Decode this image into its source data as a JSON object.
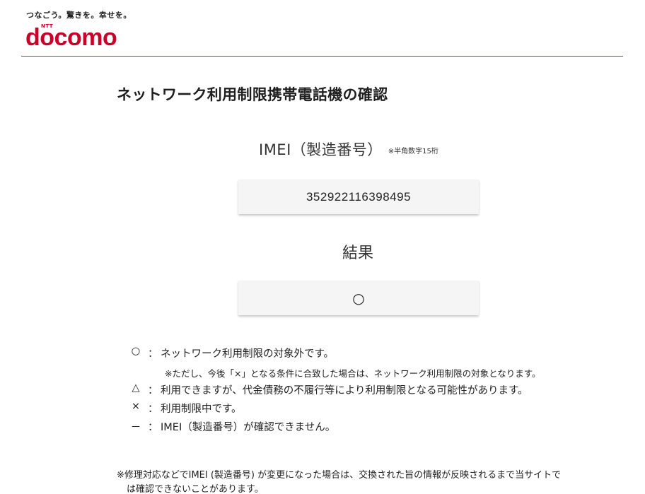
{
  "header": {
    "tagline": "つなごう。驚きを。幸せを。",
    "logo_ntt": "NTT",
    "logo_word": "docomo"
  },
  "page": {
    "title": "ネットワーク利用制限携帯電話機の確認"
  },
  "imei": {
    "label": "IMEI（製造番号）",
    "note": "※半角数字15桁",
    "value": "352922116398495"
  },
  "result": {
    "label": "結果",
    "value": "○"
  },
  "legend": {
    "items": [
      {
        "symbol": "○",
        "colon": "：",
        "text": "ネットワーク利用制限の対象外です。"
      },
      {
        "symbol": "△",
        "colon": "：",
        "text": "利用できますが、代金債務の不履行等により利用制限となる可能性があります。"
      },
      {
        "symbol": "×",
        "colon": "：",
        "text": "利用制限中です。"
      },
      {
        "symbol": "－",
        "colon": "：",
        "text": "IMEI（製造番号）が確認できません。"
      }
    ],
    "sub_note": "※ただし、今後「×」となる条件に合致した場合は、ネットワーク利用制限の対象となります。"
  },
  "footnote": {
    "line1": "※修理対応などでIMEI (製造番号) が変更になった場合は、交換された旨の情報が反映されるまで当サイトで",
    "line2": "は確認できないことがあります。"
  },
  "colors": {
    "brand": "#c8002a",
    "rule": "#9b3a4a",
    "box_bg": "#f5f5f5"
  }
}
